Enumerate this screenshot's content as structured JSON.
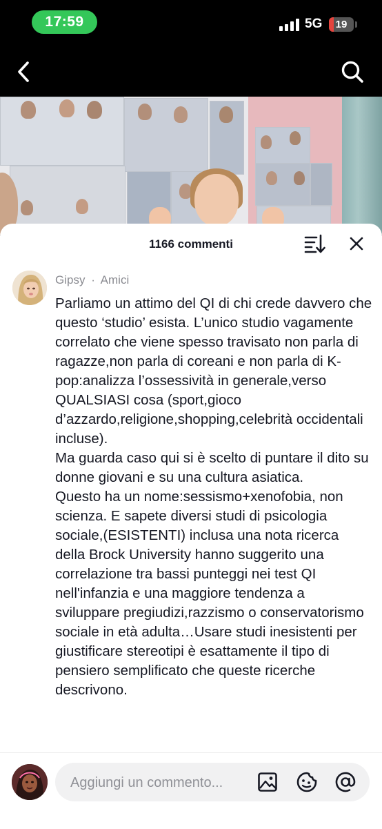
{
  "status_bar": {
    "time": "17:59",
    "network": "5G",
    "battery_level": "19",
    "battery_color": "#e5443d"
  },
  "nav": {
    "back_icon": "chevron-left-icon",
    "search_icon": "search-icon"
  },
  "comments_panel": {
    "count_label": "1166 commenti",
    "sort_icon": "sort-icon",
    "close_icon": "close-icon"
  },
  "comment": {
    "author": "Gipsy",
    "separator": "·",
    "relation": "Amici",
    "text": "Parliamo un attimo del QI di chi crede davvero che questo ‘studio’ esista. L’unico studio vagamente correlato che viene spesso travisato non parla di ragazze,non parla di coreani e non parla di K-pop:analizza l’ossessività in generale,verso QUALSIASI cosa (sport,gioco d’azzardo,religione,shopping,celebrità occidentali incluse).\nMa guarda caso qui si è scelto di puntare il dito su donne giovani e su una cultura asiatica.\nQuesto ha un nome:sessismo+xenofobia, non scienza. E sapete diversi studi di psicologia sociale,(ESISTENTI) inclusa una nota ricerca della Brock University hanno suggerito una correlazione tra bassi punteggi nei test QI nell'infanzia e una maggiore tendenza a sviluppare pregiudizi,razzismo o conservatorismo sociale in età adulta…Usare studi inesistenti per giustificare stereotipi è esattamente il tipo di pensiero semplificato che queste ricerche descrivono."
  },
  "composer": {
    "placeholder": "Aggiungi un commento...",
    "icons": [
      "image-icon",
      "emoji-icon",
      "mention-icon"
    ]
  },
  "colors": {
    "status_pill": "#34c759",
    "text_primary": "#161823",
    "text_secondary": "#8a8b91"
  }
}
